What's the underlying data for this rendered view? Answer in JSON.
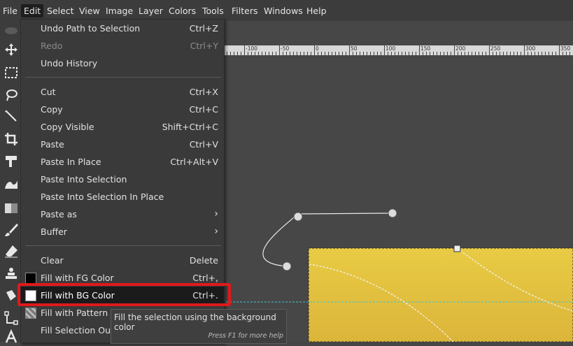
{
  "menubar": {
    "items": [
      {
        "label": "File"
      },
      {
        "label": "Edit"
      },
      {
        "label": "Select"
      },
      {
        "label": "View"
      },
      {
        "label": "Image"
      },
      {
        "label": "Layer"
      },
      {
        "label": "Colors"
      },
      {
        "label": "Tools"
      },
      {
        "label": "Filters"
      },
      {
        "label": "Windows"
      },
      {
        "label": "Help"
      }
    ]
  },
  "ruler": {
    "labels": [
      "-100",
      "-50",
      "0",
      "50",
      "100",
      "150",
      "200",
      "250",
      "300",
      "350"
    ]
  },
  "edit_menu": {
    "items": [
      {
        "label": "Undo Path to Selection",
        "accel": "Ctrl+Z"
      },
      {
        "label": "Redo",
        "accel": "Ctrl+Y"
      },
      {
        "label": "Undo History",
        "accel": ""
      },
      {
        "label": "Cut",
        "accel": "Ctrl+X"
      },
      {
        "label": "Copy",
        "accel": "Ctrl+C"
      },
      {
        "label": "Copy Visible",
        "accel": "Shift+Ctrl+C"
      },
      {
        "label": "Paste",
        "accel": "Ctrl+V"
      },
      {
        "label": "Paste In Place",
        "accel": "Ctrl+Alt+V"
      },
      {
        "label": "Paste Into Selection",
        "accel": ""
      },
      {
        "label": "Paste Into Selection In Place",
        "accel": ""
      },
      {
        "label": "Paste as",
        "accel": "›"
      },
      {
        "label": "Buffer",
        "accel": "›"
      },
      {
        "label": "Clear",
        "accel": "Delete"
      },
      {
        "label": "Fill with FG Color",
        "accel": "Ctrl+,"
      },
      {
        "label": "Fill with BG Color",
        "accel": "Ctrl+."
      },
      {
        "label": "Fill with Pattern",
        "accel": ""
      },
      {
        "label": "Fill Selection Outline...",
        "accel": ""
      }
    ]
  },
  "tooltip": {
    "text": "Fill the selection using the background color",
    "hint": "Press F1 for more help"
  },
  "colors": {
    "selection_fill": "#e2bf3c",
    "highlight_border": "#e0191b"
  }
}
